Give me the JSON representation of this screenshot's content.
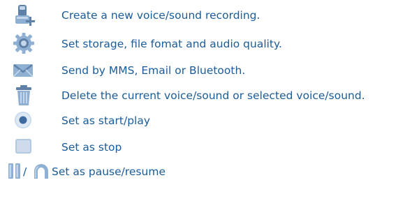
{
  "options": [
    {
      "icon": "record-icon",
      "text": "Create a new voice/sound recording."
    },
    {
      "icon": "gear-icon",
      "text": "Set storage, file fomat and audio quality."
    },
    {
      "icon": "envelope-icon",
      "text": "Send by MMS, Email or Bluetooth."
    },
    {
      "icon": "trash-icon",
      "text": "Delete the current voice/sound or selected voice/sound."
    },
    {
      "icon": "play-icon",
      "text": "Set as start/play"
    },
    {
      "icon": "stop-icon",
      "text": "Set as stop"
    },
    {
      "icon": "pause-resume-icon",
      "text": "Set as pause/resume"
    }
  ],
  "icon_separator": "/",
  "colors": {
    "text": "#1a5c9a",
    "icon_dark": "#5f81a8",
    "icon_mid": "#8fb0d2",
    "icon_light": "#c5d7ea"
  }
}
